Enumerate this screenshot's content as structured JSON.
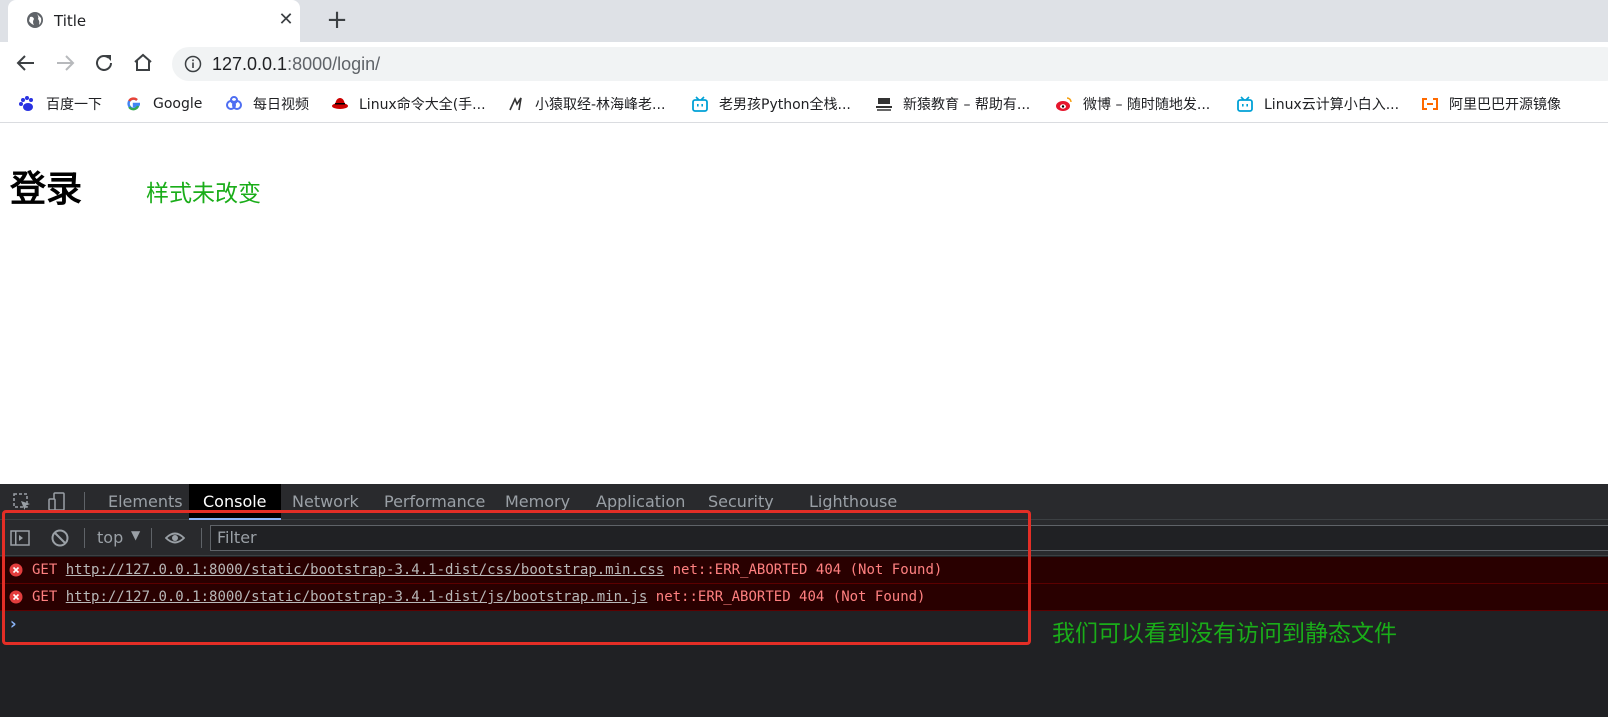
{
  "tab": {
    "title": "Title",
    "close": "✕",
    "new_tab": "+"
  },
  "address_bar": {
    "host": "127.0.0.1",
    "rest": ":8000/login/"
  },
  "bookmarks": [
    {
      "label": "百度一下",
      "icon": "baidu-icon"
    },
    {
      "label": "Google",
      "icon": "google-icon"
    },
    {
      "label": "每日视频",
      "icon": "video-icon"
    },
    {
      "label": "Linux命令大全(手...",
      "icon": "redhat-icon"
    },
    {
      "label": "小猿取经-林海峰老...",
      "icon": "monkey-icon"
    },
    {
      "label": "老男孩Python全栈...",
      "icon": "bilibili-icon"
    },
    {
      "label": "新猿教育 – 帮助有...",
      "icon": "school-icon"
    },
    {
      "label": "微博 – 随时随地发...",
      "icon": "weibo-icon"
    },
    {
      "label": "Linux云计算小白入...",
      "icon": "bilibili-icon"
    },
    {
      "label": "阿里巴巴开源镜像",
      "icon": "aliyun-icon"
    }
  ],
  "page": {
    "heading": "登录",
    "annotation": "样式未改变"
  },
  "devtools": {
    "tabs": [
      "Elements",
      "Console",
      "Network",
      "Performance",
      "Memory",
      "Application",
      "Security",
      "Lighthouse"
    ],
    "active_tab": "Console",
    "context": "top",
    "filter_placeholder": "Filter",
    "messages": [
      {
        "method": "GET",
        "url": "http://127.0.0.1:8000/static/bootstrap-3.4.1-dist/css/bootstrap.min.css",
        "error": "net::ERR_ABORTED 404 (Not Found)"
      },
      {
        "method": "GET",
        "url": "http://127.0.0.1:8000/static/bootstrap-3.4.1-dist/js/bootstrap.min.js",
        "error": "net::ERR_ABORTED 404 (Not Found)"
      }
    ],
    "prompt": "›"
  },
  "annotation2": "我们可以看到没有访问到静态文件",
  "colors": {
    "annotation": "#1aad19",
    "highlight_box": "#e32e26",
    "error_text": "#ff8080",
    "error_bg": "#290000"
  }
}
